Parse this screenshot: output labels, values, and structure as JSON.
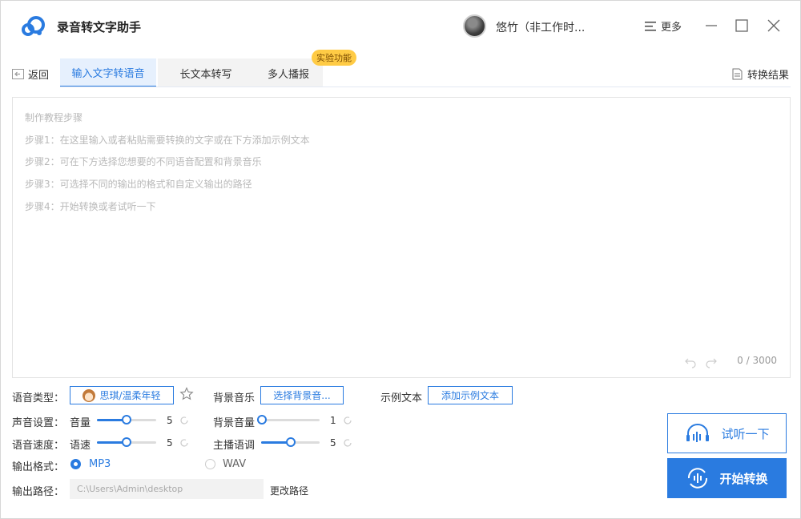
{
  "app": {
    "title": "录音转文字助手",
    "accent_color": "#2a7be0"
  },
  "header": {
    "username": "悠竹（非工作时...",
    "more_label": "更多"
  },
  "nav": {
    "back_label": "返回",
    "tabs": [
      {
        "label": "输入文字转语音",
        "active": true
      },
      {
        "label": "长文本转写",
        "active": false
      },
      {
        "label": "多人播报",
        "active": false
      }
    ],
    "badge": "实验功能",
    "result_label": "转换结果"
  },
  "editor": {
    "placeholder_lines": [
      "制作教程步骤",
      "步骤1：在这里输入或者粘贴需要转换的文字或在下方添加示例文本",
      "步骤2：可在下方选择您想要的不同语音配置和背景音乐",
      "步骤3：可选择不同的输出的格式和自定义输出的路径",
      "步骤4：开始转换或者试听一下"
    ],
    "counter": "0 / 3000"
  },
  "settings": {
    "voice_type_label": "语音类型：",
    "voice_name": "思琪/温柔年轻",
    "bg_music_label": "背景音乐",
    "bg_music_button": "选择背景音...",
    "example_label": "示例文本",
    "example_button": "添加示例文本",
    "sound_label": "声音设置：",
    "volume_label": "音量",
    "volume_value": "5",
    "volume_level": 0.5,
    "bg_volume_label": "背景音量",
    "bg_volume_value": "1",
    "bg_volume_level": 0,
    "speed_label": "语音速度：",
    "speed_sub_label": "语速",
    "speed_value": "5",
    "speed_level": 0.5,
    "pitch_label": "主播语调",
    "pitch_value": "5",
    "pitch_level": 0.5,
    "format_label": "输出格式：",
    "format_options": [
      {
        "label": "MP3",
        "selected": true
      },
      {
        "label": "WAV",
        "selected": false
      }
    ],
    "path_label": "输出路径：",
    "path_value": "C:\\Users\\Admin\\desktop",
    "change_path_label": "更改路径"
  },
  "actions": {
    "listen_label": "试听一下",
    "start_label": "开始转换"
  }
}
